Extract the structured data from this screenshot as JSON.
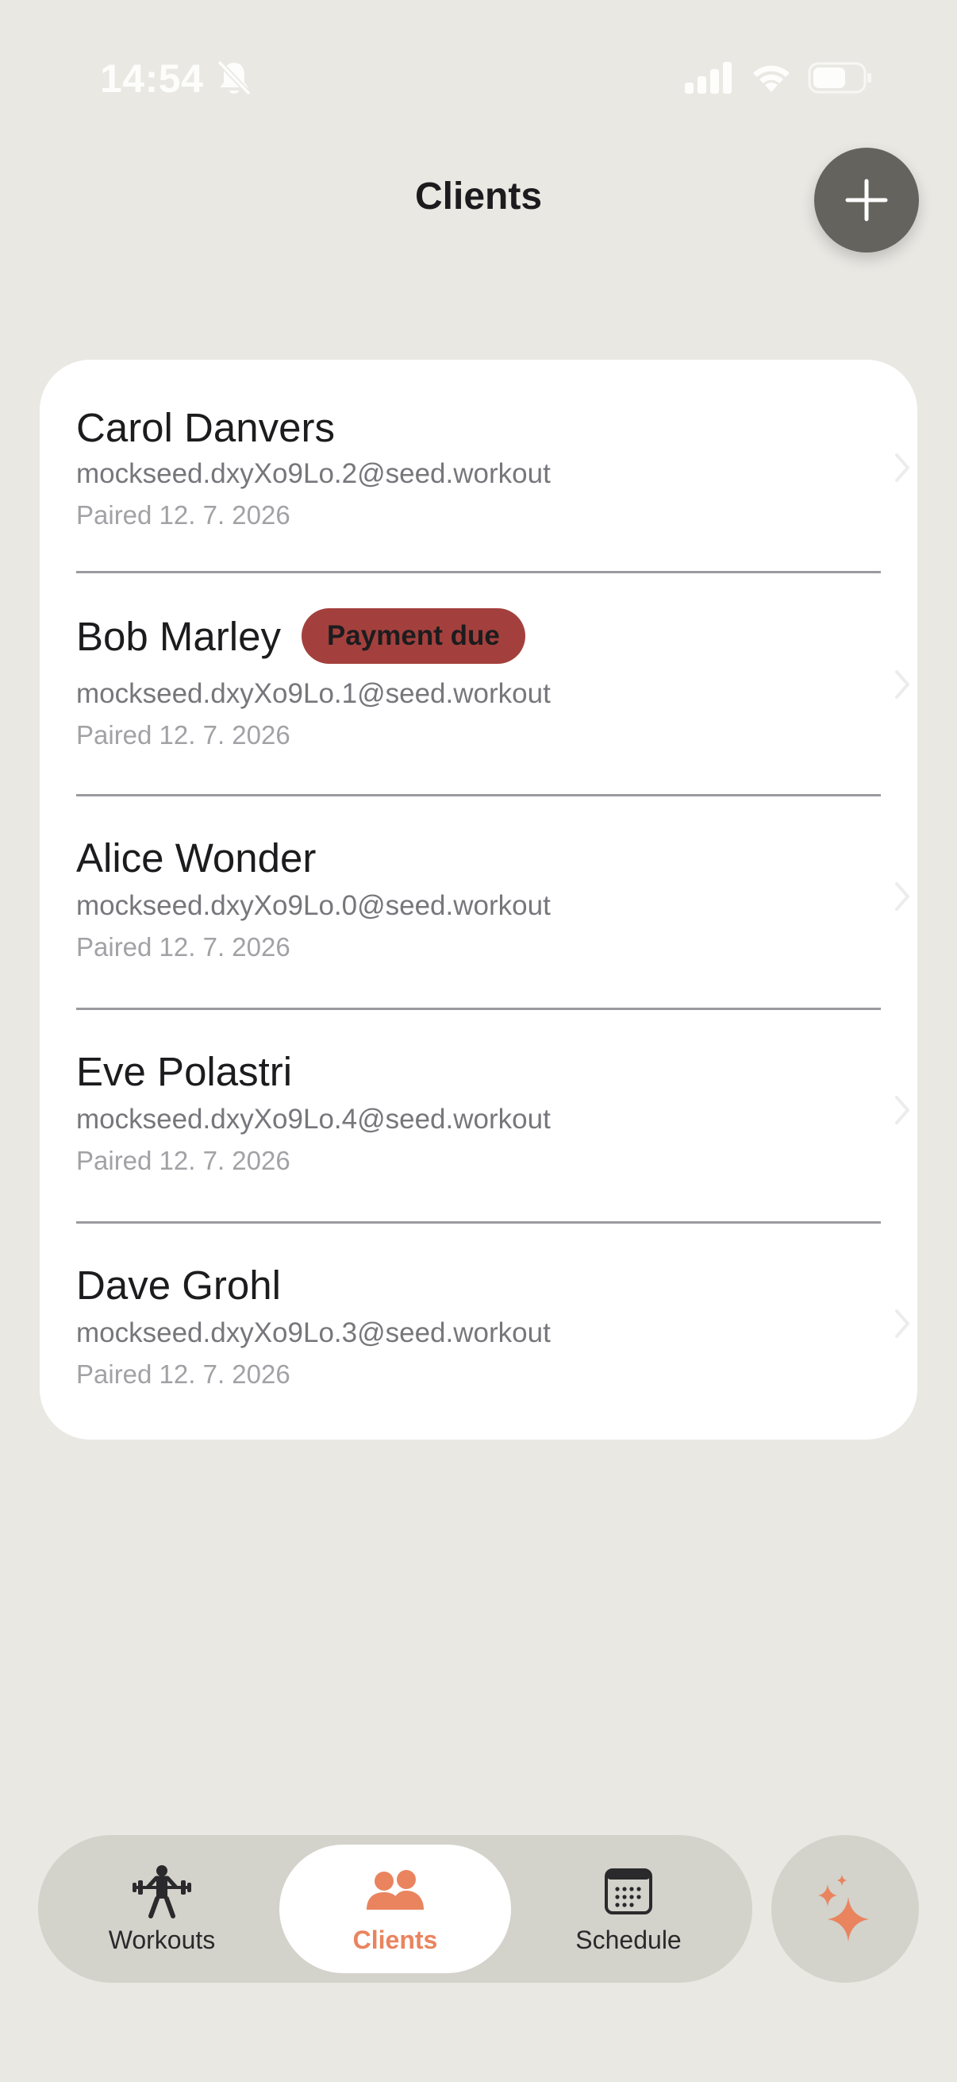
{
  "status_bar": {
    "time": "14:54",
    "icons": [
      "bell-slash-icon",
      "cellular-signal-icon",
      "wifi-icon",
      "battery-icon"
    ]
  },
  "header": {
    "title": "Clients",
    "add_icon": "plus-icon"
  },
  "clients": [
    {
      "name": "Carol Danvers",
      "email": "mockseed.dxyXo9Lo.2@seed.workout",
      "paired": "Paired 12. 7. 2026",
      "badge": ""
    },
    {
      "name": "Bob Marley",
      "email": "mockseed.dxyXo9Lo.1@seed.workout",
      "paired": "Paired 12. 7. 2026",
      "badge": "Payment due"
    },
    {
      "name": "Alice Wonder",
      "email": "mockseed.dxyXo9Lo.0@seed.workout",
      "paired": "Paired 12. 7. 2026",
      "badge": ""
    },
    {
      "name": "Eve Polastri",
      "email": "mockseed.dxyXo9Lo.4@seed.workout",
      "paired": "Paired 12. 7. 2026",
      "badge": ""
    },
    {
      "name": "Dave Grohl",
      "email": "mockseed.dxyXo9Lo.3@seed.workout",
      "paired": "Paired 12. 7. 2026",
      "badge": ""
    }
  ],
  "tab_bar": {
    "tabs": [
      {
        "label": "Workouts",
        "icon": "weightlifter-icon",
        "active": false
      },
      {
        "label": "Clients",
        "icon": "people-icon",
        "active": true
      },
      {
        "label": "Schedule",
        "icon": "calendar-icon",
        "active": false
      }
    ],
    "ai_icon": "sparkles-icon"
  },
  "colors": {
    "background": "#e9e8e3",
    "accent": "#e9845f",
    "badge": "#a3403d",
    "add_button": "#64635d",
    "tab_bar": "#d3d2cb"
  }
}
